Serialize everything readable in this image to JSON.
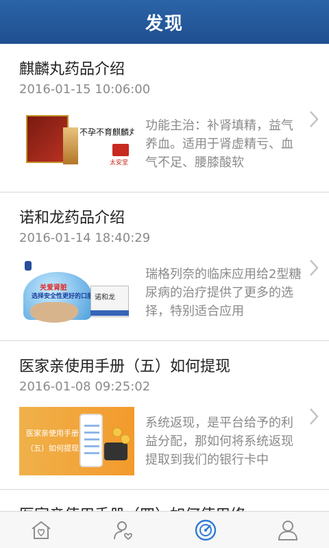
{
  "header": {
    "title": "发现"
  },
  "articles": [
    {
      "title": "麒麟丸药品介绍",
      "date": "2016-01-15 10:06:00",
      "excerpt": "功能主治：补肾填精，益气养血。适用于肾虚精亏、血气不足、腰膝酸软",
      "thumb": {
        "box_label": "麒麟丸",
        "slogan": "不孕不育麒麟丸",
        "brand": "太安堂"
      }
    },
    {
      "title": "诺和龙药品介绍",
      "date": "2016-01-14 18:40:29",
      "excerpt": "瑞格列奈的临床应用给2型糖尿病的治疗提供了更多的选择，特别适合应用",
      "thumb": {
        "line1": "关爱肾脏",
        "line2": "选择安全性更好的口服降糖药",
        "pack": "诺和龙"
      }
    },
    {
      "title": "医家亲使用手册（五）如何提现",
      "date": "2016-01-08 09:25:02",
      "excerpt": "系统返现，是平台给予的利益分配，那如何将系统返现提取到我们的银行卡中",
      "thumb": {
        "line1": "医家亲使用手册",
        "line2": "（五）如何提现"
      }
    },
    {
      "title": "医家亲使用手册（四）如何使用修"
    }
  ],
  "tabbar": {
    "items": [
      {
        "icon": "home-heart-icon",
        "active": false
      },
      {
        "icon": "doctor-heart-icon",
        "active": false
      },
      {
        "icon": "discover-compass-icon",
        "active": true
      },
      {
        "icon": "profile-icon",
        "active": false
      }
    ],
    "active_color": "#2d7ad6",
    "inactive_color": "#8c8c8c"
  }
}
